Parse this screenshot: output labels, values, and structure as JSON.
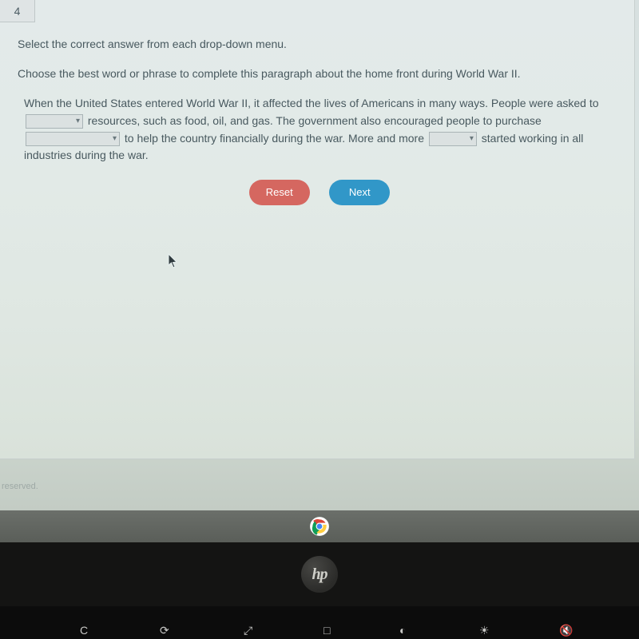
{
  "question_number": "4",
  "instruction_line1": "Select the correct answer from each drop-down menu.",
  "instruction_line2": "Choose the best word or phrase to complete this paragraph about the home front during World War II.",
  "paragraph": {
    "seg1": "When the United States entered World War II, it affected the lives of Americans in many ways. People were asked to ",
    "seg2": " resources, such as food, oil, and gas. The government also encouraged people to purchase ",
    "seg3": " to help the country financially during the war. More and more ",
    "seg4": " started working in all industries during the war."
  },
  "dropdowns": {
    "d1": "",
    "d2": "",
    "d3": ""
  },
  "buttons": {
    "reset": "Reset",
    "next": "Next"
  },
  "footer": "reserved.",
  "logo_text": "hp",
  "colors": {
    "reset": "#d56760",
    "next": "#3197c8"
  }
}
